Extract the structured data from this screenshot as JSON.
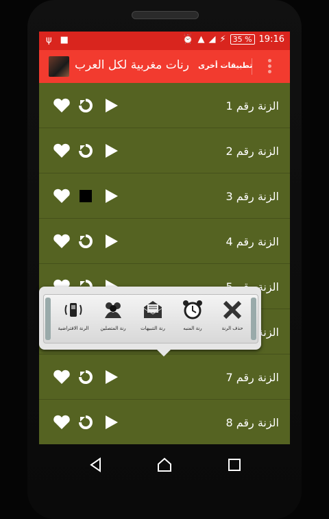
{
  "status_bar": {
    "time": "19:16",
    "battery": "35 %",
    "left_icons": [
      "usb-icon",
      "android-debug-icon"
    ],
    "right_icons": [
      "alarm-icon",
      "wifi-icon",
      "signal-icon",
      "charging-icon"
    ]
  },
  "app_bar": {
    "title": "رنات مغربية لكل العرب",
    "other_apps": "تطبيقات أخرى",
    "background": "#f23b2f"
  },
  "list": {
    "background": "#556322",
    "items": [
      {
        "label": "الزنة رقم 1",
        "state": "replay"
      },
      {
        "label": "الزنة رقم 2",
        "state": "replay"
      },
      {
        "label": "الزنة رقم 3",
        "state": "stop"
      },
      {
        "label": "الزنة رقم 4",
        "state": "replay"
      },
      {
        "label": "الزنة رقم 5",
        "state": "replay"
      },
      {
        "label": "الزنة رقم 6",
        "state": "replay"
      },
      {
        "label": "الزنة رقم 7",
        "state": "replay"
      },
      {
        "label": "الزنة رقم 8",
        "state": "replay"
      }
    ]
  },
  "quick_actions": [
    {
      "label": "حذف الرنة",
      "icon": "close-icon"
    },
    {
      "label": "رنة المنبه",
      "icon": "alarm-clock-icon"
    },
    {
      "label": "رنة التنبيهات",
      "icon": "envelope-icon"
    },
    {
      "label": "رنة المتصلين",
      "icon": "contacts-icon"
    },
    {
      "label": "الرنة الافتراضية",
      "icon": "ringing-phone-icon"
    }
  ],
  "nav": [
    "back-icon",
    "home-icon",
    "recents-icon"
  ]
}
